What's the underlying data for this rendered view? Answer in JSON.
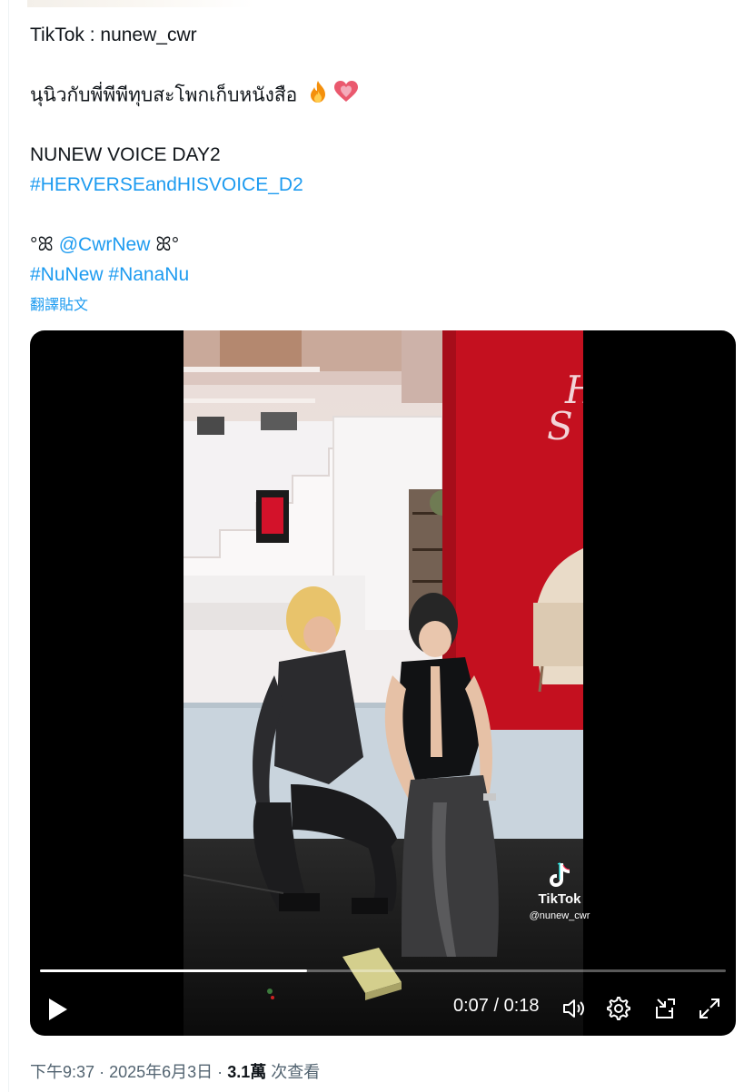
{
  "tweet": {
    "line1": "TikTok : nunew_cwr",
    "line2": "นุนิวกับพี่พีพีทุบสะโพกเก็บหนังสือ",
    "line3": "NUNEW VOICE DAY2",
    "hashtag1": "#HERVERSEandHISVOICE_D2",
    "mention_prefix": "°ꕤ",
    "mention": "@CwrNew",
    "mention_suffix": "ꕤ°",
    "hashtag2": "#NuNew",
    "hashtag3": "#NanaNu",
    "translate_label": "翻譯貼文"
  },
  "video": {
    "time_current": "0:07",
    "time_separator": "/",
    "time_total": "0:18",
    "progress": 0.39,
    "watermark_name": "TikTok",
    "watermark_handle": "@nunew_cwr"
  },
  "meta": {
    "time": "下午9:37",
    "sep1": "·",
    "date": "2025年6月3日",
    "sep2": "·",
    "views_count": "3.1萬",
    "views_label": "次查看"
  },
  "colors": {
    "link": "#1d9bf0",
    "text": "#0f1419",
    "muted": "#536471",
    "stage_red": "#d3122a"
  },
  "icons": [
    "play-icon",
    "volume-icon",
    "settings-icon",
    "pip-icon",
    "fullscreen-icon",
    "tiktok-logo-icon",
    "fire-emoji-icon",
    "heart-emoji-icon"
  ]
}
